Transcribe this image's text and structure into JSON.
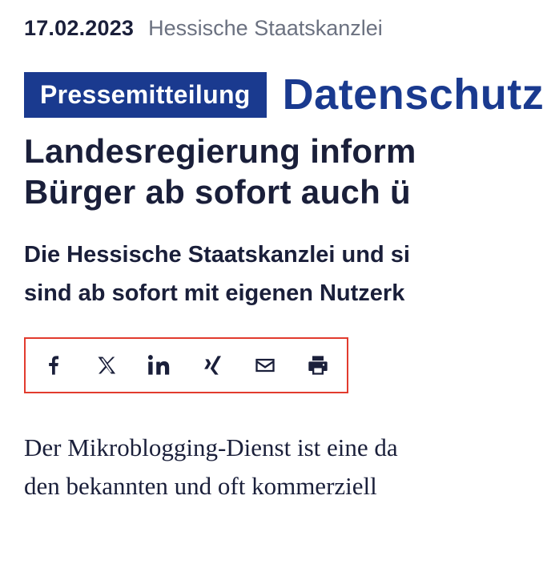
{
  "meta": {
    "date": "17.02.2023",
    "source": "Hessische Staatskanzlei"
  },
  "badge": "Pressemitteilung",
  "topic": "Datenschutz",
  "headline_line1": "Landesregierung inform",
  "headline_line2": "Bürger ab sofort auch ü",
  "lede_line1": "Die Hessische Staatskanzlei und si",
  "lede_line2": "sind ab sofort mit eigenen Nutzerk",
  "share": {
    "facebook": "facebook-icon",
    "x": "x-twitter-icon",
    "linkedin": "linkedin-icon",
    "xing": "xing-icon",
    "email": "email-icon",
    "print": "print-icon"
  },
  "body_line1": "Der Mikroblogging-Dienst ist eine da",
  "body_line2": "den bekannten und oft kommerziell"
}
